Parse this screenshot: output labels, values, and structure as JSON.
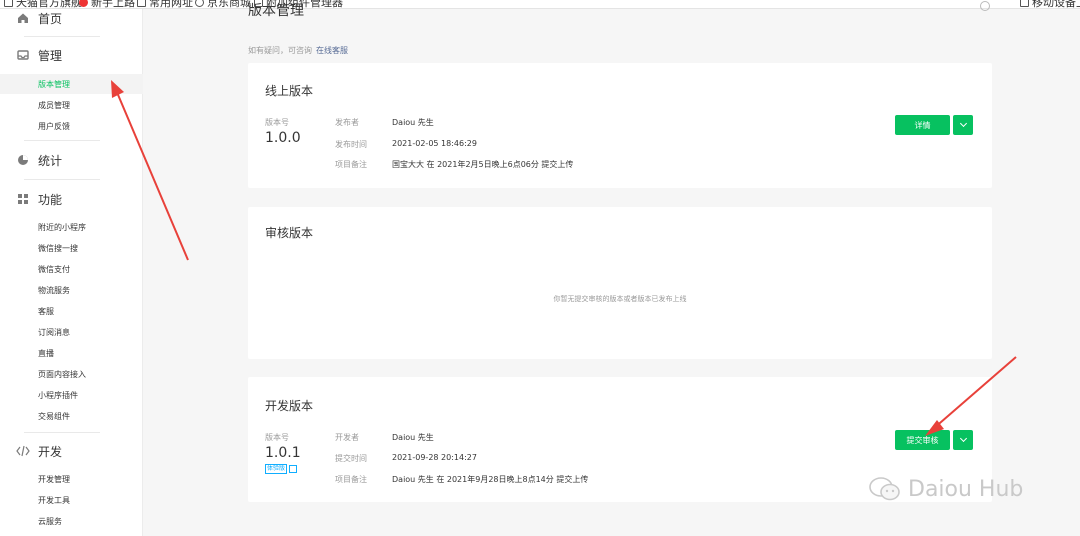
{
  "bookmarks": [
    {
      "label": "天猫官方旗舰",
      "icon": "page-icon"
    },
    {
      "label": "新手上路",
      "icon": "firefox-icon"
    },
    {
      "label": "常用网址",
      "icon": "folder-icon"
    },
    {
      "label": "京东商城",
      "icon": "globe-icon"
    },
    {
      "label": "附加组件管理器",
      "icon": "page-icon"
    },
    {
      "label": "移动设备上的",
      "icon": "folder-icon"
    }
  ],
  "sidebar": {
    "home": "首页",
    "groups": [
      {
        "label": "管理",
        "icon": "inbox-icon",
        "items": [
          "版本管理",
          "成员管理",
          "用户反馈"
        ]
      },
      {
        "label": "统计",
        "icon": "pie-chart-icon",
        "items": []
      },
      {
        "label": "功能",
        "icon": "grid-icon",
        "items": [
          "附近的小程序",
          "微信搜一搜",
          "微信支付",
          "物流服务",
          "客服",
          "订阅消息",
          "直播",
          "页面内容接入",
          "小程序插件",
          "交易组件"
        ]
      },
      {
        "label": "开发",
        "icon": "code-icon",
        "items": [
          "开发管理",
          "开发工具",
          "云服务"
        ]
      }
    ],
    "active_item": "版本管理"
  },
  "page": {
    "title": "版本管理",
    "hint": "如有疑问，可咨询",
    "hint_link": "在线客服"
  },
  "online": {
    "title": "线上版本",
    "version_label": "版本号",
    "version": "1.0.0",
    "publisher_label": "发布者",
    "publisher": "Daiou 先生",
    "time_label": "发布时间",
    "time": "2021-02-05 18:46:29",
    "note_label": "项目备注",
    "note": "国宝大大 在 2021年2月5日晚上6点06分 提交上传",
    "button": "详情"
  },
  "review": {
    "title": "审核版本",
    "empty": "你暂无提交审核的版本或者版本已发布上线"
  },
  "dev": {
    "title": "开发版本",
    "version_label": "版本号",
    "version": "1.0.1",
    "badge": "体验版",
    "developer_label": "开发者",
    "developer": "Daiou 先生",
    "time_label": "提交时间",
    "time": "2021-09-28 20:14:27",
    "note_label": "项目备注",
    "note": "Daiou 先生 在 2021年9月28日晚上8点14分 提交上传",
    "button": "提交审核"
  },
  "watermark": "Daiou Hub",
  "colors": {
    "primary": "#07c160",
    "annotation": "#e8413a",
    "link": "#576b95"
  }
}
